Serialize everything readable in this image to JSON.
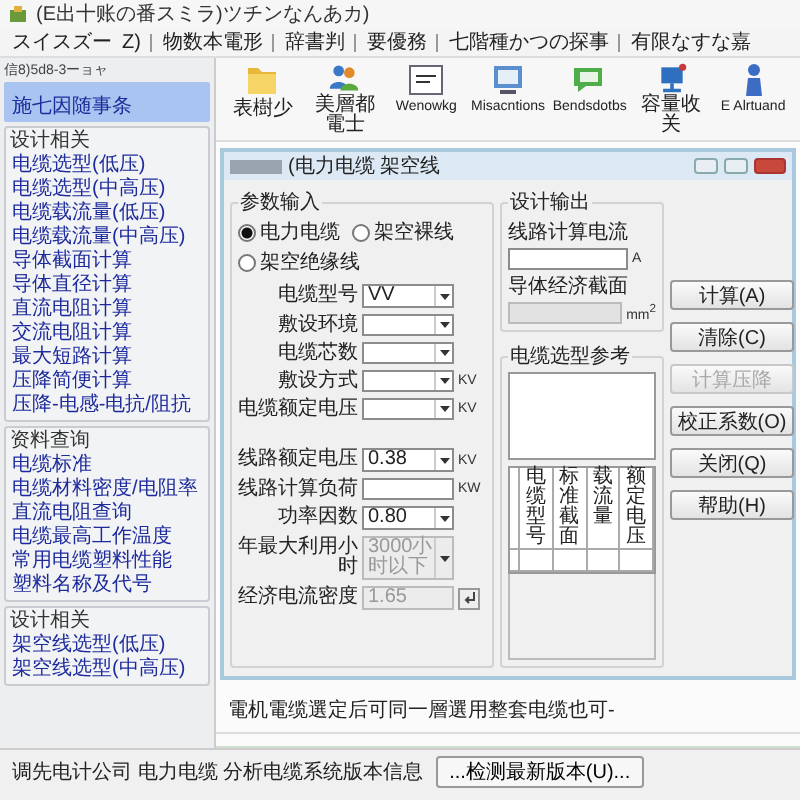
{
  "window": {
    "title": "(E出十账の番スミラ)ツチンなんあカ)"
  },
  "menu": [
    "スイスズー",
    "Z)",
    "物数本電形",
    "辞書判",
    "要優務",
    "七階種かつの探事",
    "有限なすな嘉"
  ],
  "panel_caption": "信8)5d8-3ーョャ",
  "quick_item": {
    "label": "施七因随事条",
    "selected": true
  },
  "toolbar": [
    {
      "label": "表樹少",
      "kind": "folder"
    },
    {
      "label": "美層都電士",
      "kind": "people"
    },
    {
      "label": "Wenowkg",
      "kind": "panel"
    },
    {
      "label": "Misacntions",
      "kind": "monitor"
    },
    {
      "label": "Bendsdotbs",
      "kind": "chat"
    },
    {
      "label": "容量收关",
      "kind": "network"
    },
    {
      "label": "E Alrtuand",
      "kind": "figure"
    }
  ],
  "sidebar": [
    {
      "title": "设计相关",
      "items": [
        "电缆选型(低压)",
        "电缆选型(中高压)",
        "电缆载流量(低压)",
        "电缆载流量(中高压)",
        "导体截面计算",
        "导体直径计算",
        "直流电阻计算",
        "交流电阻计算",
        "最大短路计算",
        "压降简便计算",
        "压降-电感-电抗/阻抗"
      ]
    },
    {
      "title": "资料查询",
      "items": [
        "电缆标准",
        "电缆材料密度/电阻率",
        "直流电阻查询",
        "电缆最高工作温度",
        "常用电缆塑料性能",
        "塑料名称及代号"
      ]
    },
    {
      "title": "设计相关",
      "items": [
        "架空线选型(低压)",
        "架空线选型(中高压)"
      ]
    }
  ],
  "dialog": {
    "title": "(电力电缆 架空线",
    "input_group": {
      "title": "参数输入",
      "modes": [
        {
          "label": "电力电缆",
          "selected": true
        },
        {
          "label": "架空裸线",
          "selected": false
        },
        {
          "label": "架空绝缘线",
          "selected": false
        }
      ],
      "cable_fields": [
        {
          "label": "电缆型号",
          "kind": "combo",
          "value": "VV",
          "disabled": false
        },
        {
          "label": "敷设环境",
          "kind": "combo",
          "disabled": false
        },
        {
          "label": "电缆芯数",
          "kind": "combo",
          "disabled": false
        },
        {
          "label": "敷设方式",
          "kind": "combo",
          "unit": "KV",
          "disabled": false
        },
        {
          "label": "电缆额定电压",
          "kind": "combo",
          "unit": "KV",
          "disabled": false
        }
      ],
      "line_fields": [
        {
          "label": "线路额定电压",
          "kind": "combo",
          "value": "0.38",
          "unit": "KV",
          "disabled": false
        },
        {
          "label": "线路计算负荷",
          "kind": "text",
          "unit": "KW",
          "disabled": false
        },
        {
          "label": "功率因数",
          "kind": "combo",
          "value": "0.80",
          "disabled": false
        },
        {
          "label": "年最大利用小时",
          "kind": "combo",
          "value": "3000小时以下",
          "disabled": true
        },
        {
          "label": "经济电流密度",
          "kind": "text-button",
          "value": "1.65",
          "disabled": true
        }
      ]
    },
    "output_group": {
      "title": "设计输出",
      "fields": [
        {
          "label": "线路计算电流",
          "unit": "A",
          "disabled": false
        },
        {
          "label": "导体经济截面",
          "unit": "mm$^{2}$",
          "disabled": true
        }
      ]
    },
    "reference": {
      "title": "电缆选型参考",
      "columns": [
        "电缆型号",
        "标准截面",
        "载流量",
        "额定电压"
      ]
    },
    "buttons": [
      {
        "label": "计算(A)",
        "disabled": false
      },
      {
        "label": "清除(C)",
        "disabled": false
      },
      {
        "label": "计算压降",
        "disabled": true
      },
      {
        "label": "校正系数(O)",
        "disabled": false
      },
      {
        "label": "关闭(Q)",
        "disabled": false
      },
      {
        "label": "帮助(H)",
        "disabled": false
      }
    ]
  },
  "message": "電机電缆選定后可同一層選用整套电缆也可-",
  "status_bar": {
    "text": "调先电计公司 电力电缆 分析电缆系统版本信息",
    "button": "...检测最新版本(U)..."
  }
}
